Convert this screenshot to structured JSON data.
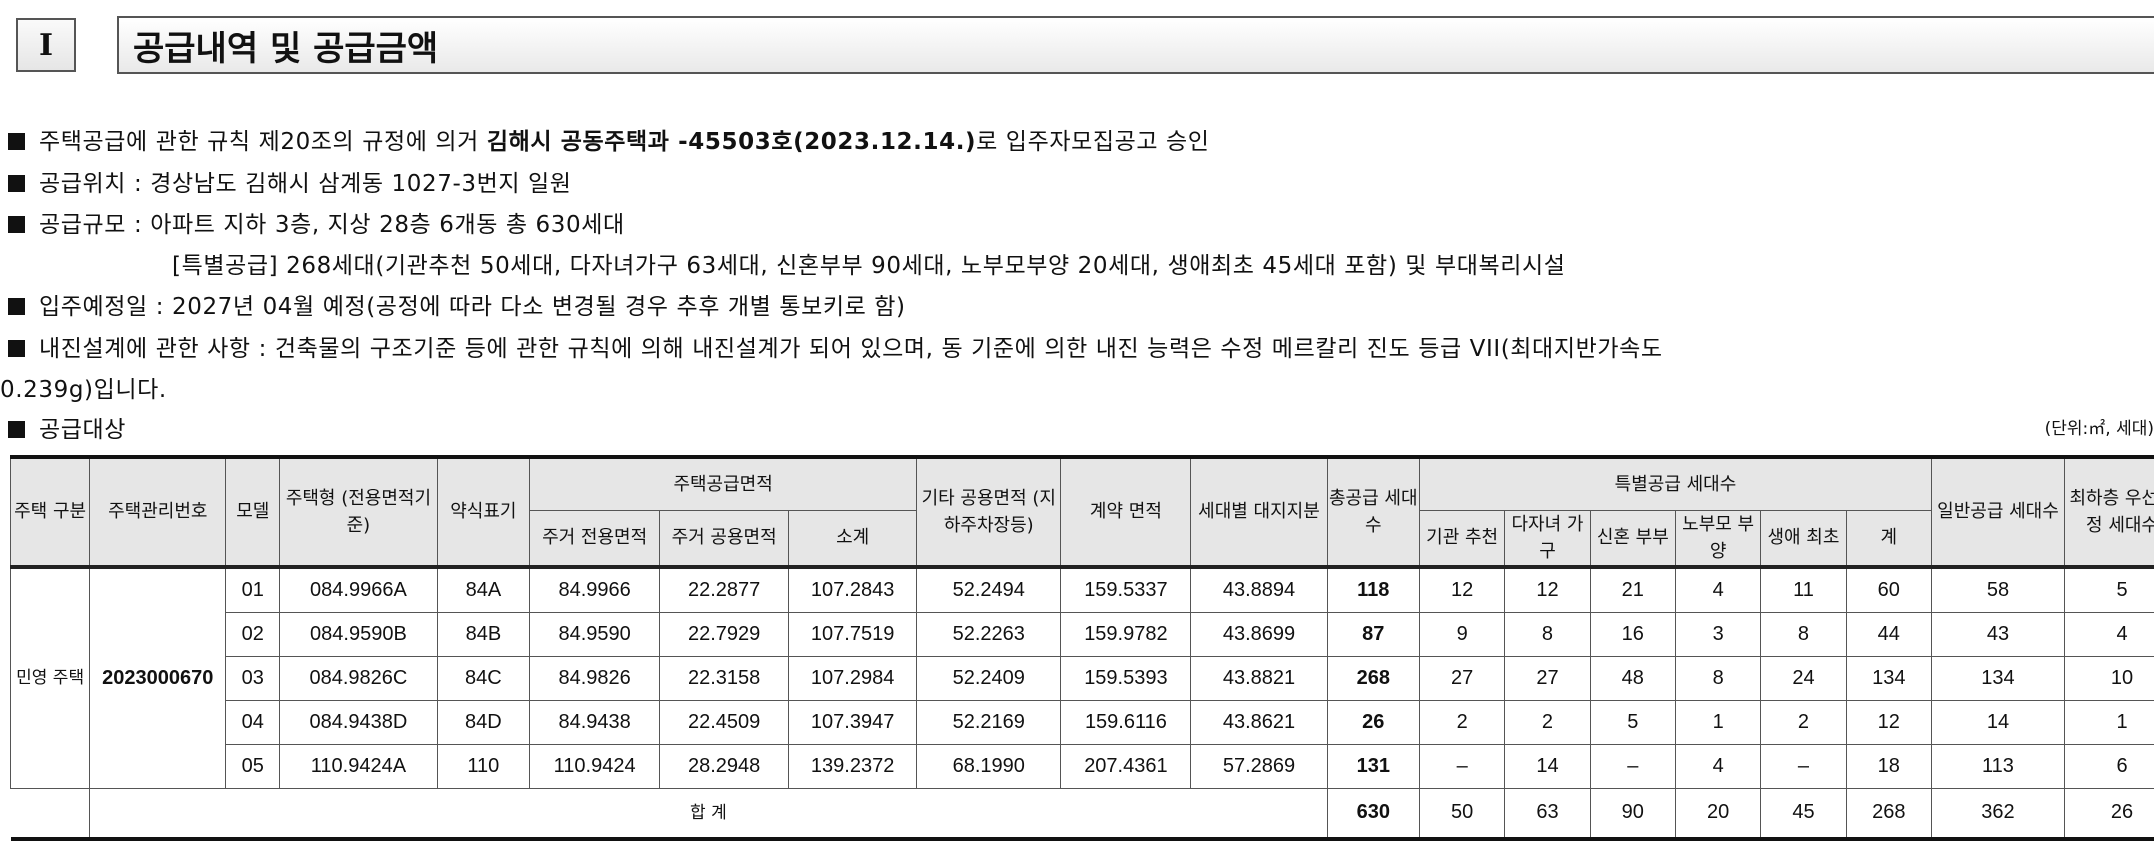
{
  "section": {
    "number": "I",
    "title": "공급내역 및 공급금액"
  },
  "lines": {
    "approval_pre": "주택공급에 관한 규칙 제20조의 규정에 의거 ",
    "approval_bold": "김해시 공동주택과 -45503호(2023.12.14.)",
    "approval_post": "로 입주자모집공고 승인",
    "location": "공급위치 : 경상남도 김해시 삼계동 1027-3번지 일원",
    "scale": "공급규모 : 아파트 지하 3층, 지상 28층 6개동 총 630세대",
    "scale_detail": "[특별공급] 268세대(기관추천 50세대, 다자녀가구 63세대, 신혼부부 90세대, 노부모부양 20세대, 생애최초 45세대 포함) 및 부대복리시설",
    "move_in": "입주예정일 : 2027년 04월 예정(공정에 따라 다소 변경될 경우 추후 개별 통보키로 함)",
    "seismic_1": "내진설계에 관한 사항 : 건축물의 구조기준 등에 관한 규칙에 의해 내진설계가 되어 있으며, 동 기준에 의한 내진 능력은 수정 메르칼리 진도 등급 VII(최대지반가속도",
    "seismic_2": "0.239g)입니다.",
    "target": "공급대상"
  },
  "unit_label": "(단위:㎡, 세대)",
  "table": {
    "headers": {
      "housing_type": "주택 구분",
      "mgmt_no": "주택관리번호",
      "model": "모델",
      "house_type": "주택형 (전용면적기준)",
      "abbr": "약식표기",
      "supply_area": "주택공급면적",
      "exclusive": "주거 전용면적",
      "common": "주거 공용면적",
      "subtotal": "소계",
      "other_common": "기타 공용면적 (지하주차장등)",
      "contract_area": "계약 면적",
      "land_share": "세대별 대지지분",
      "total_supply": "총공급 세대수",
      "special": "특별공급 세대수",
      "institution": "기관 추천",
      "multi_child": "다자녀 가구",
      "newlywed": "신혼 부부",
      "elderly": "노부모 부양",
      "first_time": "생애 최초",
      "sp_total": "계",
      "general": "일반공급 세대수",
      "top_floor": "최하층 우선배정 세대수"
    },
    "housing_type_value": "민영 주택",
    "mgmt_no_value": "2023000670",
    "rows": [
      {
        "model": "01",
        "type": "084.9966A",
        "abbr": "84A",
        "exclusive": "84.9966",
        "common": "22.2877",
        "subtotal": "107.2843",
        "other": "52.2494",
        "contract": "159.5337",
        "land": "43.8894",
        "total": "118",
        "inst": "12",
        "multi": "12",
        "newly": "21",
        "elder": "4",
        "first": "11",
        "sp": "60",
        "general": "58",
        "low": "5"
      },
      {
        "model": "02",
        "type": "084.9590B",
        "abbr": "84B",
        "exclusive": "84.9590",
        "common": "22.7929",
        "subtotal": "107.7519",
        "other": "52.2263",
        "contract": "159.9782",
        "land": "43.8699",
        "total": "87",
        "inst": "9",
        "multi": "8",
        "newly": "16",
        "elder": "3",
        "first": "8",
        "sp": "44",
        "general": "43",
        "low": "4"
      },
      {
        "model": "03",
        "type": "084.9826C",
        "abbr": "84C",
        "exclusive": "84.9826",
        "common": "22.3158",
        "subtotal": "107.2984",
        "other": "52.2409",
        "contract": "159.5393",
        "land": "43.8821",
        "total": "268",
        "inst": "27",
        "multi": "27",
        "newly": "48",
        "elder": "8",
        "first": "24",
        "sp": "134",
        "general": "134",
        "low": "10"
      },
      {
        "model": "04",
        "type": "084.9438D",
        "abbr": "84D",
        "exclusive": "84.9438",
        "common": "22.4509",
        "subtotal": "107.3947",
        "other": "52.2169",
        "contract": "159.6116",
        "land": "43.8621",
        "total": "26",
        "inst": "2",
        "multi": "2",
        "newly": "5",
        "elder": "1",
        "first": "2",
        "sp": "12",
        "general": "14",
        "low": "1"
      },
      {
        "model": "05",
        "type": "110.9424A",
        "abbr": "110",
        "exclusive": "110.9424",
        "common": "28.2948",
        "subtotal": "139.2372",
        "other": "68.1990",
        "contract": "207.4361",
        "land": "57.2869",
        "total": "131",
        "inst": "–",
        "multi": "14",
        "newly": "–",
        "elder": "4",
        "first": "–",
        "sp": "18",
        "general": "113",
        "low": "6"
      }
    ],
    "total_row": {
      "label": "합 계",
      "total": "630",
      "inst": "50",
      "multi": "63",
      "newly": "90",
      "elder": "20",
      "first": "45",
      "sp": "268",
      "general": "362",
      "low": "26"
    }
  }
}
